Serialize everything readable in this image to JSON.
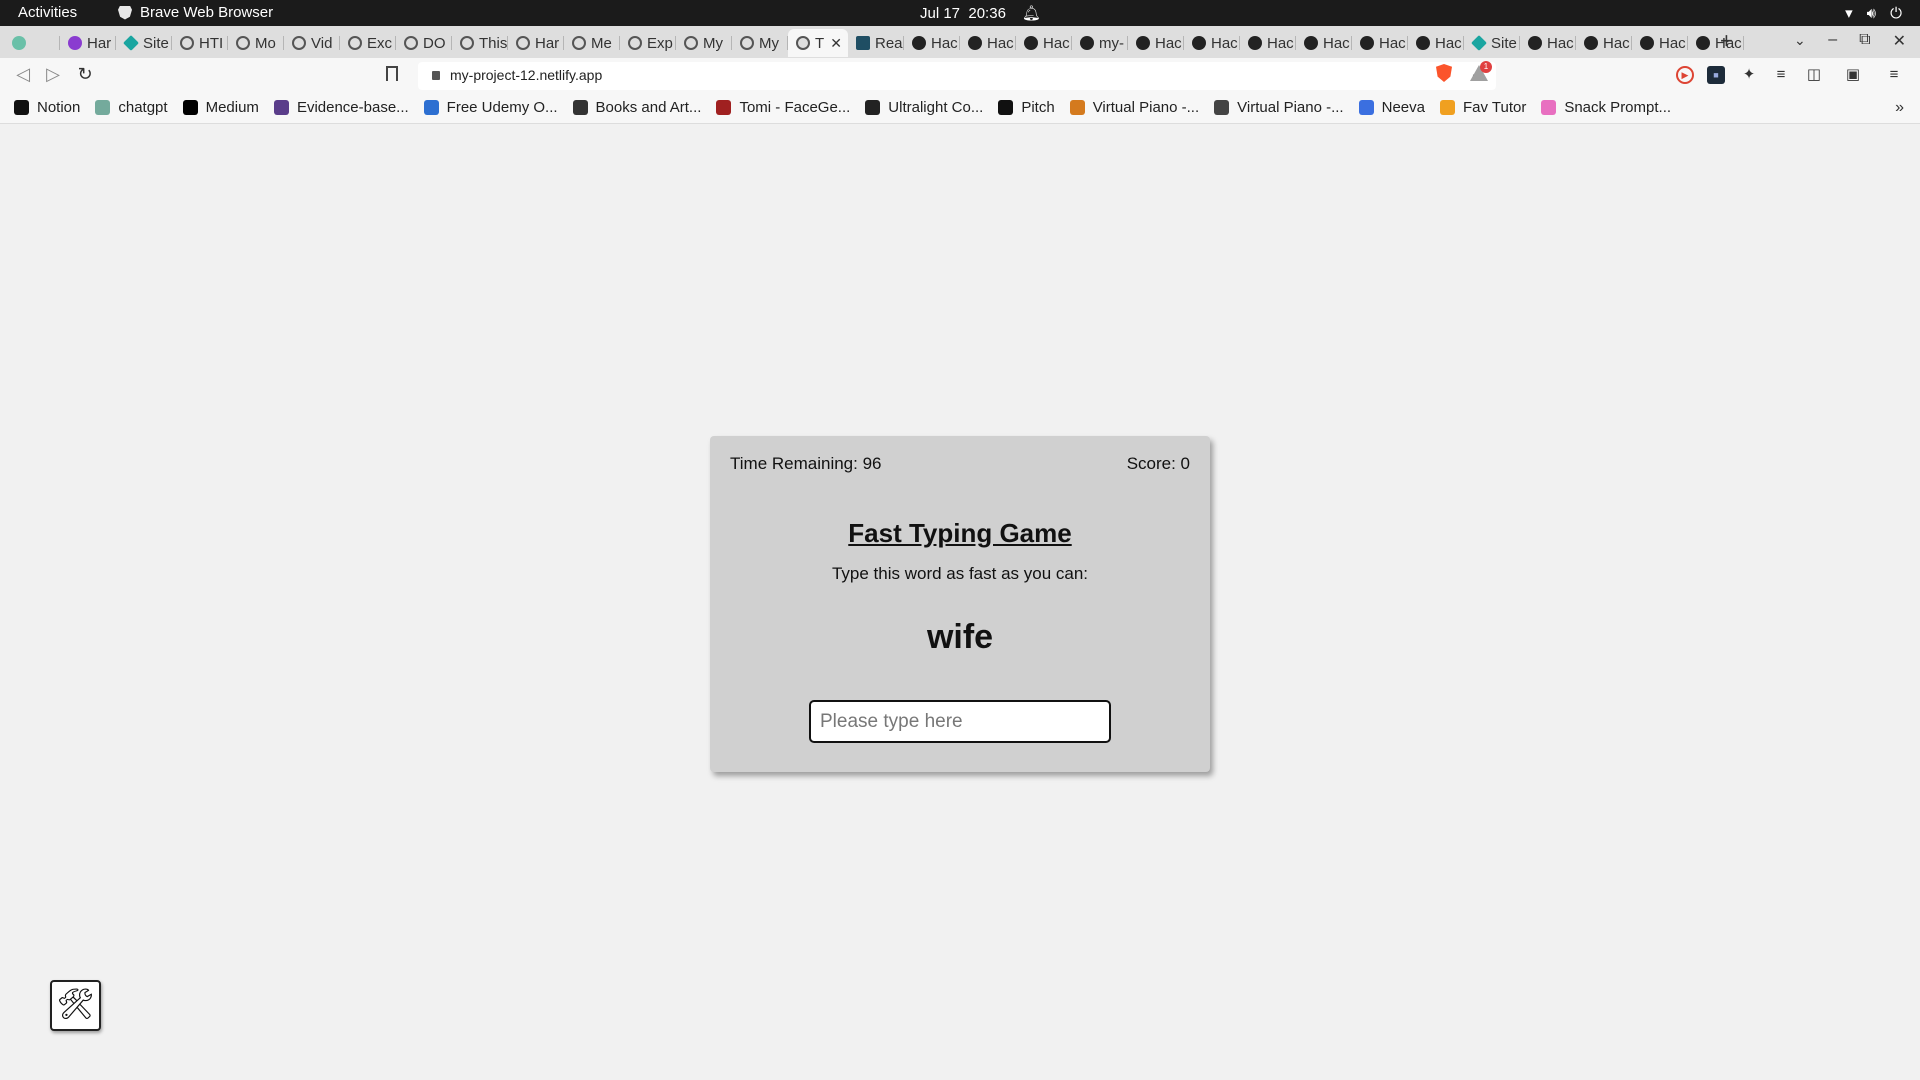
{
  "system": {
    "activities": "Activities",
    "app_name": "Brave Web Browser",
    "date": "Jul 17",
    "time": "20:36",
    "icons": [
      "wifi-icon",
      "volume-icon",
      "power-icon"
    ]
  },
  "tabs": [
    {
      "label": "",
      "icon": "green"
    },
    {
      "label": "Har",
      "icon": "purple"
    },
    {
      "label": "Site",
      "icon": "teal"
    },
    {
      "label": "HTI",
      "icon": "globe"
    },
    {
      "label": "Mo",
      "icon": "globe"
    },
    {
      "label": "Vid",
      "icon": "globe"
    },
    {
      "label": "Exc",
      "icon": "globe"
    },
    {
      "label": "DO",
      "icon": "globe"
    },
    {
      "label": "This",
      "icon": "globe"
    },
    {
      "label": "Har",
      "icon": "globe"
    },
    {
      "label": "Me",
      "icon": "globe"
    },
    {
      "label": "Exp",
      "icon": "globe"
    },
    {
      "label": "My",
      "icon": "globe"
    },
    {
      "label": "My",
      "icon": "globe"
    },
    {
      "label": "T",
      "icon": "globe",
      "active": true
    },
    {
      "label": "Rea",
      "icon": "react"
    },
    {
      "label": "Hac",
      "icon": "gh"
    },
    {
      "label": "Hac",
      "icon": "gh"
    },
    {
      "label": "Hac",
      "icon": "gh"
    },
    {
      "label": "my-",
      "icon": "gh"
    },
    {
      "label": "Hac",
      "icon": "gh"
    },
    {
      "label": "Hac",
      "icon": "gh"
    },
    {
      "label": "Hac",
      "icon": "gh"
    },
    {
      "label": "Hac",
      "icon": "gh"
    },
    {
      "label": "Hac",
      "icon": "gh"
    },
    {
      "label": "Hac",
      "icon": "gh"
    },
    {
      "label": "Site",
      "icon": "teal"
    },
    {
      "label": "Hac",
      "icon": "gh"
    },
    {
      "label": "Hac",
      "icon": "gh"
    },
    {
      "label": "Hac",
      "icon": "gh"
    },
    {
      "label": "Hac",
      "icon": "gh"
    }
  ],
  "toolbar": {
    "url": "my-project-12.netlify.app",
    "rewards_count": "1"
  },
  "bookmarks": [
    {
      "label": "Notion",
      "color": "#111111"
    },
    {
      "label": "chatgpt",
      "color": "#74aa9c"
    },
    {
      "label": "Medium",
      "color": "#000000"
    },
    {
      "label": "Evidence-base...",
      "color": "#5a3d8a"
    },
    {
      "label": "Free Udemy O...",
      "color": "#2d6fd1"
    },
    {
      "label": "Books and Art...",
      "color": "#333333"
    },
    {
      "label": "Tomi - FaceGe...",
      "color": "#a02020"
    },
    {
      "label": "Ultralight Co...",
      "color": "#222222"
    },
    {
      "label": "Pitch",
      "color": "#111111"
    },
    {
      "label": "Virtual Piano -...",
      "color": "#d47a1e"
    },
    {
      "label": "Virtual Piano -...",
      "color": "#444444"
    },
    {
      "label": "Neeva",
      "color": "#3b6fe0"
    },
    {
      "label": "Fav Tutor",
      "color": "#f0a020"
    },
    {
      "label": "Snack Prompt...",
      "color": "#e86fc0"
    }
  ],
  "game": {
    "time_remaining": "Time Remaining: 96",
    "score": "Score: 0",
    "title": "Fast Typing Game",
    "instruction": "Type this word as fast as you can:",
    "word": "wife",
    "input_placeholder": "Please type here",
    "input_value": ""
  }
}
